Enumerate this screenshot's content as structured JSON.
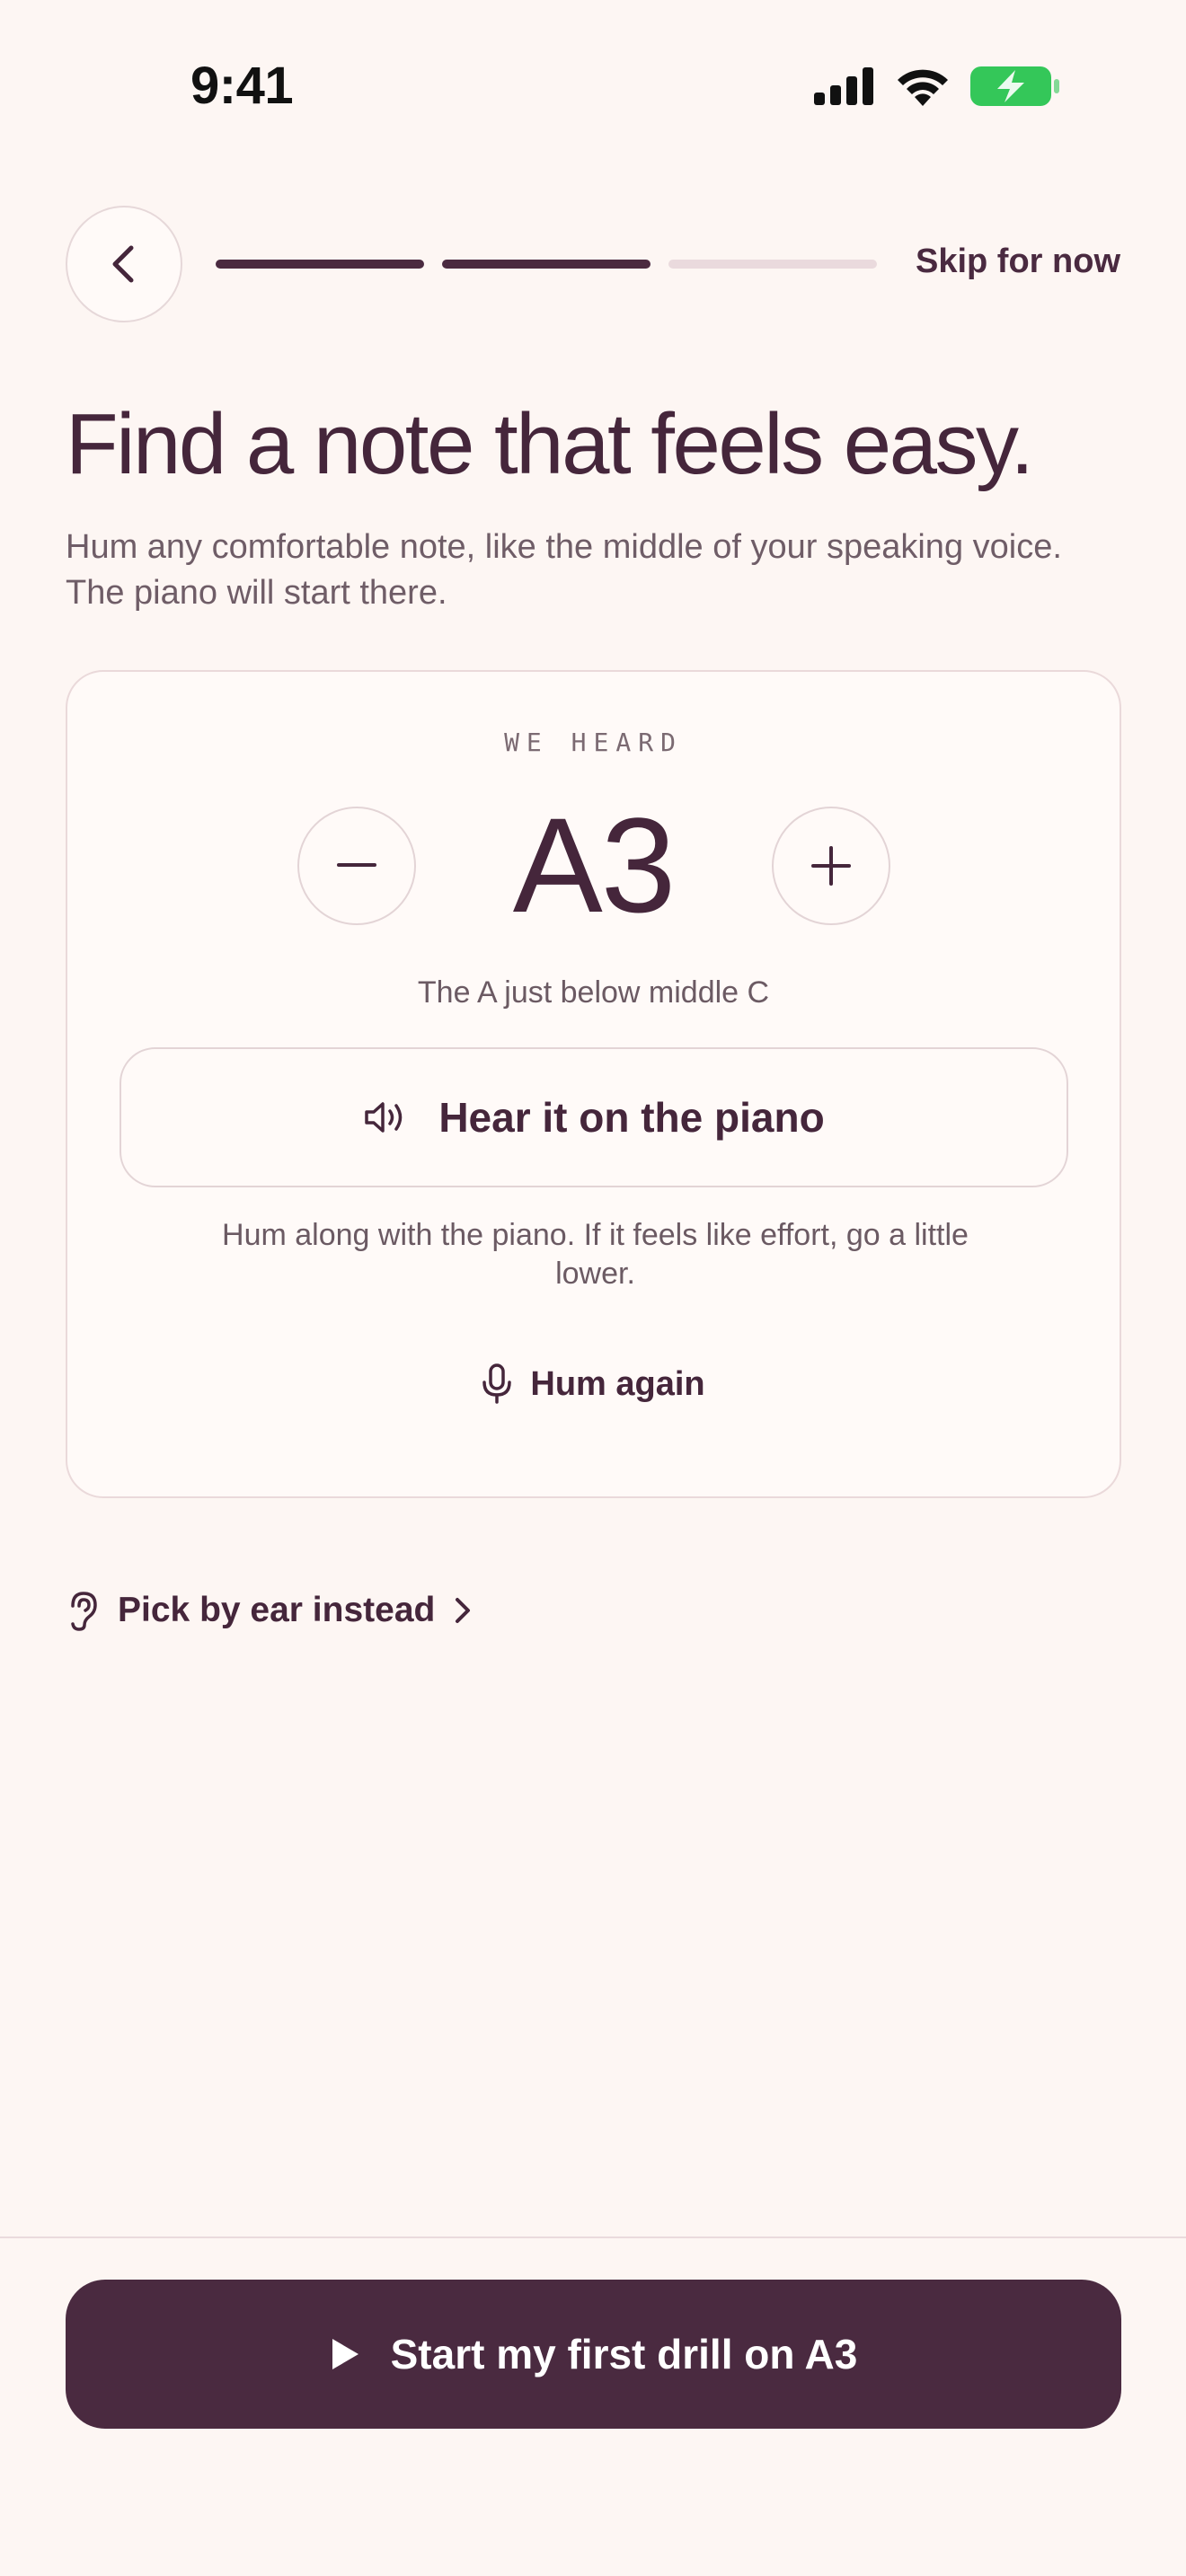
{
  "status_bar": {
    "time": "9:41"
  },
  "nav": {
    "skip_label": "Skip for now",
    "progress": {
      "total_steps": 3,
      "completed_steps": 2
    }
  },
  "heading": {
    "title": "Find a note that feels easy.",
    "subtitle": "Hum any comfortable note, like the middle of your speaking voice. The piano will start there."
  },
  "card": {
    "label": "WE HEARD",
    "note": "A3",
    "note_description": "The A just below middle C",
    "hear_label": "Hear it on the piano",
    "hint": "Hum along with the piano. If it feels like effort, go a little lower.",
    "hum_again_label": "Hum again"
  },
  "pick_by_ear_label": "Pick by ear instead",
  "cta_label": "Start my first drill on A3",
  "colors": {
    "background": "#fdf6f3",
    "primary": "#4a2a40",
    "text_secondary": "#6f5d67",
    "border": "#e6d8d9",
    "battery": "#34c759"
  }
}
